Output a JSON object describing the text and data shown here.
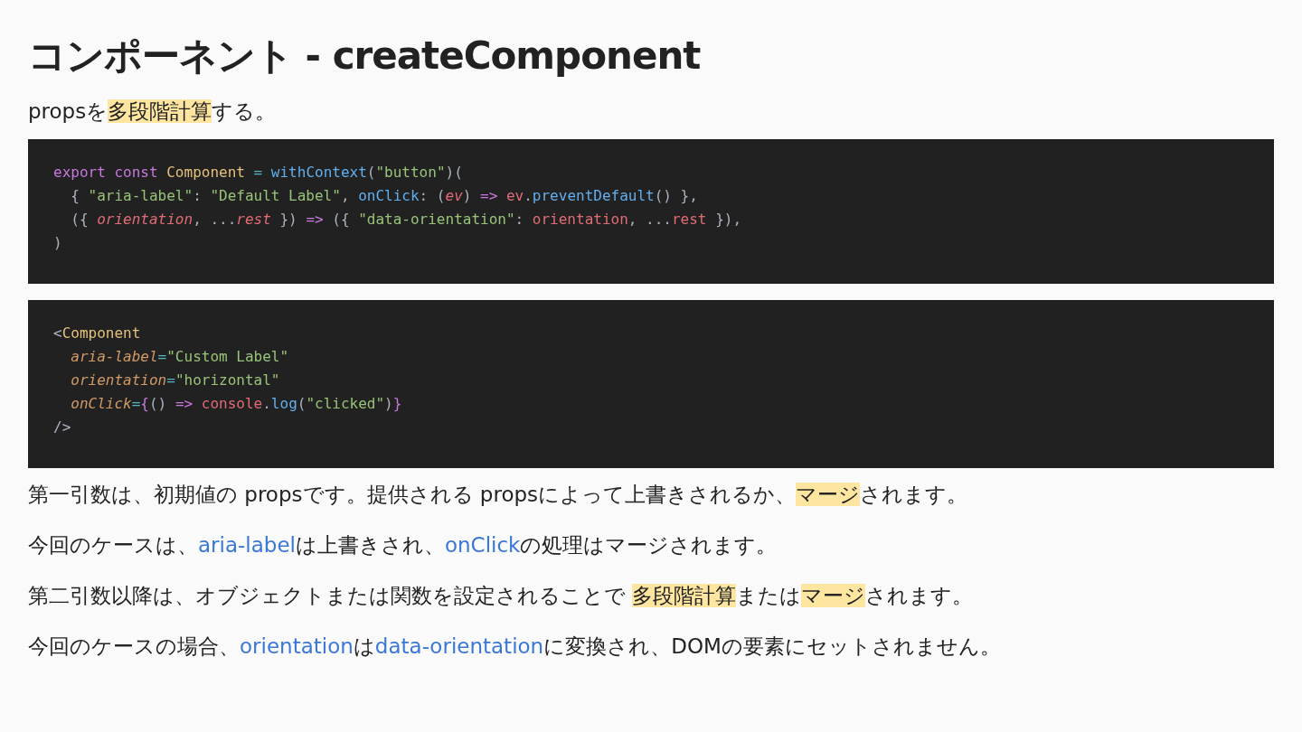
{
  "title": "コンポーネント - createComponent",
  "intro": [
    {
      "kind": "text",
      "text": "propsを"
    },
    {
      "kind": "highlight",
      "text": "多段階計算"
    },
    {
      "kind": "text",
      "text": "する。"
    }
  ],
  "code_blocks": [
    {
      "lines": [
        [
          {
            "kind": "keyword",
            "text": "export const "
          },
          {
            "kind": "class",
            "text": "Component"
          },
          {
            "kind": "op",
            "text": " = "
          },
          {
            "kind": "func",
            "text": "withContext"
          },
          {
            "kind": "plain",
            "text": "("
          },
          {
            "kind": "string",
            "text": "\"button\""
          },
          {
            "kind": "plain",
            "text": ")("
          }
        ],
        [
          {
            "kind": "plain",
            "text": "  { "
          },
          {
            "kind": "string",
            "text": "\"aria-label\""
          },
          {
            "kind": "plain",
            "text": ": "
          },
          {
            "kind": "string",
            "text": "\"Default Label\""
          },
          {
            "kind": "plain",
            "text": ", "
          },
          {
            "kind": "func",
            "text": "onClick"
          },
          {
            "kind": "plain",
            "text": ": ("
          },
          {
            "kind": "param",
            "text": "ev"
          },
          {
            "kind": "plain",
            "text": ") "
          },
          {
            "kind": "keyword",
            "text": "=>"
          },
          {
            "kind": "var",
            "text": " ev"
          },
          {
            "kind": "plain",
            "text": "."
          },
          {
            "kind": "func",
            "text": "preventDefault"
          },
          {
            "kind": "plain",
            "text": "() },"
          }
        ],
        [
          {
            "kind": "plain",
            "text": "  ({ "
          },
          {
            "kind": "param",
            "text": "orientation"
          },
          {
            "kind": "plain",
            "text": ", ..."
          },
          {
            "kind": "param",
            "text": "rest"
          },
          {
            "kind": "plain",
            "text": " }) "
          },
          {
            "kind": "keyword",
            "text": "=>"
          },
          {
            "kind": "plain",
            "text": " ({ "
          },
          {
            "kind": "string",
            "text": "\"data-orientation\""
          },
          {
            "kind": "plain",
            "text": ": "
          },
          {
            "kind": "var",
            "text": "orientation"
          },
          {
            "kind": "plain",
            "text": ", ..."
          },
          {
            "kind": "var",
            "text": "rest"
          },
          {
            "kind": "plain",
            "text": " }),"
          }
        ],
        [
          {
            "kind": "plain",
            "text": ")"
          }
        ]
      ]
    },
    {
      "lines": [
        [
          {
            "kind": "plain",
            "text": "<"
          },
          {
            "kind": "class",
            "text": "Component"
          }
        ],
        [
          {
            "kind": "attr",
            "text": "  aria-label"
          },
          {
            "kind": "op",
            "text": "="
          },
          {
            "kind": "string",
            "text": "\"Custom Label\""
          }
        ],
        [
          {
            "kind": "attr",
            "text": "  orientation"
          },
          {
            "kind": "op",
            "text": "="
          },
          {
            "kind": "string",
            "text": "\"horizontal\""
          }
        ],
        [
          {
            "kind": "attr",
            "text": "  onClick"
          },
          {
            "kind": "op",
            "text": "="
          },
          {
            "kind": "keyword",
            "text": "{"
          },
          {
            "kind": "plain",
            "text": "() "
          },
          {
            "kind": "keyword",
            "text": "=>"
          },
          {
            "kind": "var",
            "text": " console"
          },
          {
            "kind": "plain",
            "text": "."
          },
          {
            "kind": "func",
            "text": "log"
          },
          {
            "kind": "plain",
            "text": "("
          },
          {
            "kind": "string",
            "text": "\"clicked\""
          },
          {
            "kind": "plain",
            "text": ")"
          },
          {
            "kind": "keyword",
            "text": "}"
          }
        ],
        [
          {
            "kind": "plain",
            "text": "/>"
          }
        ]
      ]
    }
  ],
  "paragraphs": [
    [
      {
        "kind": "text",
        "text": "第一引数は、初期値の propsです。提供される propsによって上書きされるか、"
      },
      {
        "kind": "highlight",
        "text": "マージ"
      },
      {
        "kind": "text",
        "text": "されます。"
      }
    ],
    [
      {
        "kind": "text",
        "text": "今回のケースは、"
      },
      {
        "kind": "link",
        "text": "aria-label"
      },
      {
        "kind": "text",
        "text": "は上書きされ、"
      },
      {
        "kind": "link",
        "text": "onClick"
      },
      {
        "kind": "text",
        "text": "の処理はマージされます。"
      }
    ],
    [
      {
        "kind": "text",
        "text": "第二引数以降は、オブジェクトまたは関数を設定されることで "
      },
      {
        "kind": "highlight",
        "text": "多段階計算"
      },
      {
        "kind": "text",
        "text": "または"
      },
      {
        "kind": "highlight",
        "text": "マージ"
      },
      {
        "kind": "text",
        "text": "されます。"
      }
    ],
    [
      {
        "kind": "text",
        "text": "今回のケースの場合、"
      },
      {
        "kind": "link",
        "text": "orientation"
      },
      {
        "kind": "text",
        "text": "は"
      },
      {
        "kind": "link",
        "text": "data-orientation"
      },
      {
        "kind": "text",
        "text": "に変換され、DOMの要素にセットされません。"
      }
    ]
  ]
}
